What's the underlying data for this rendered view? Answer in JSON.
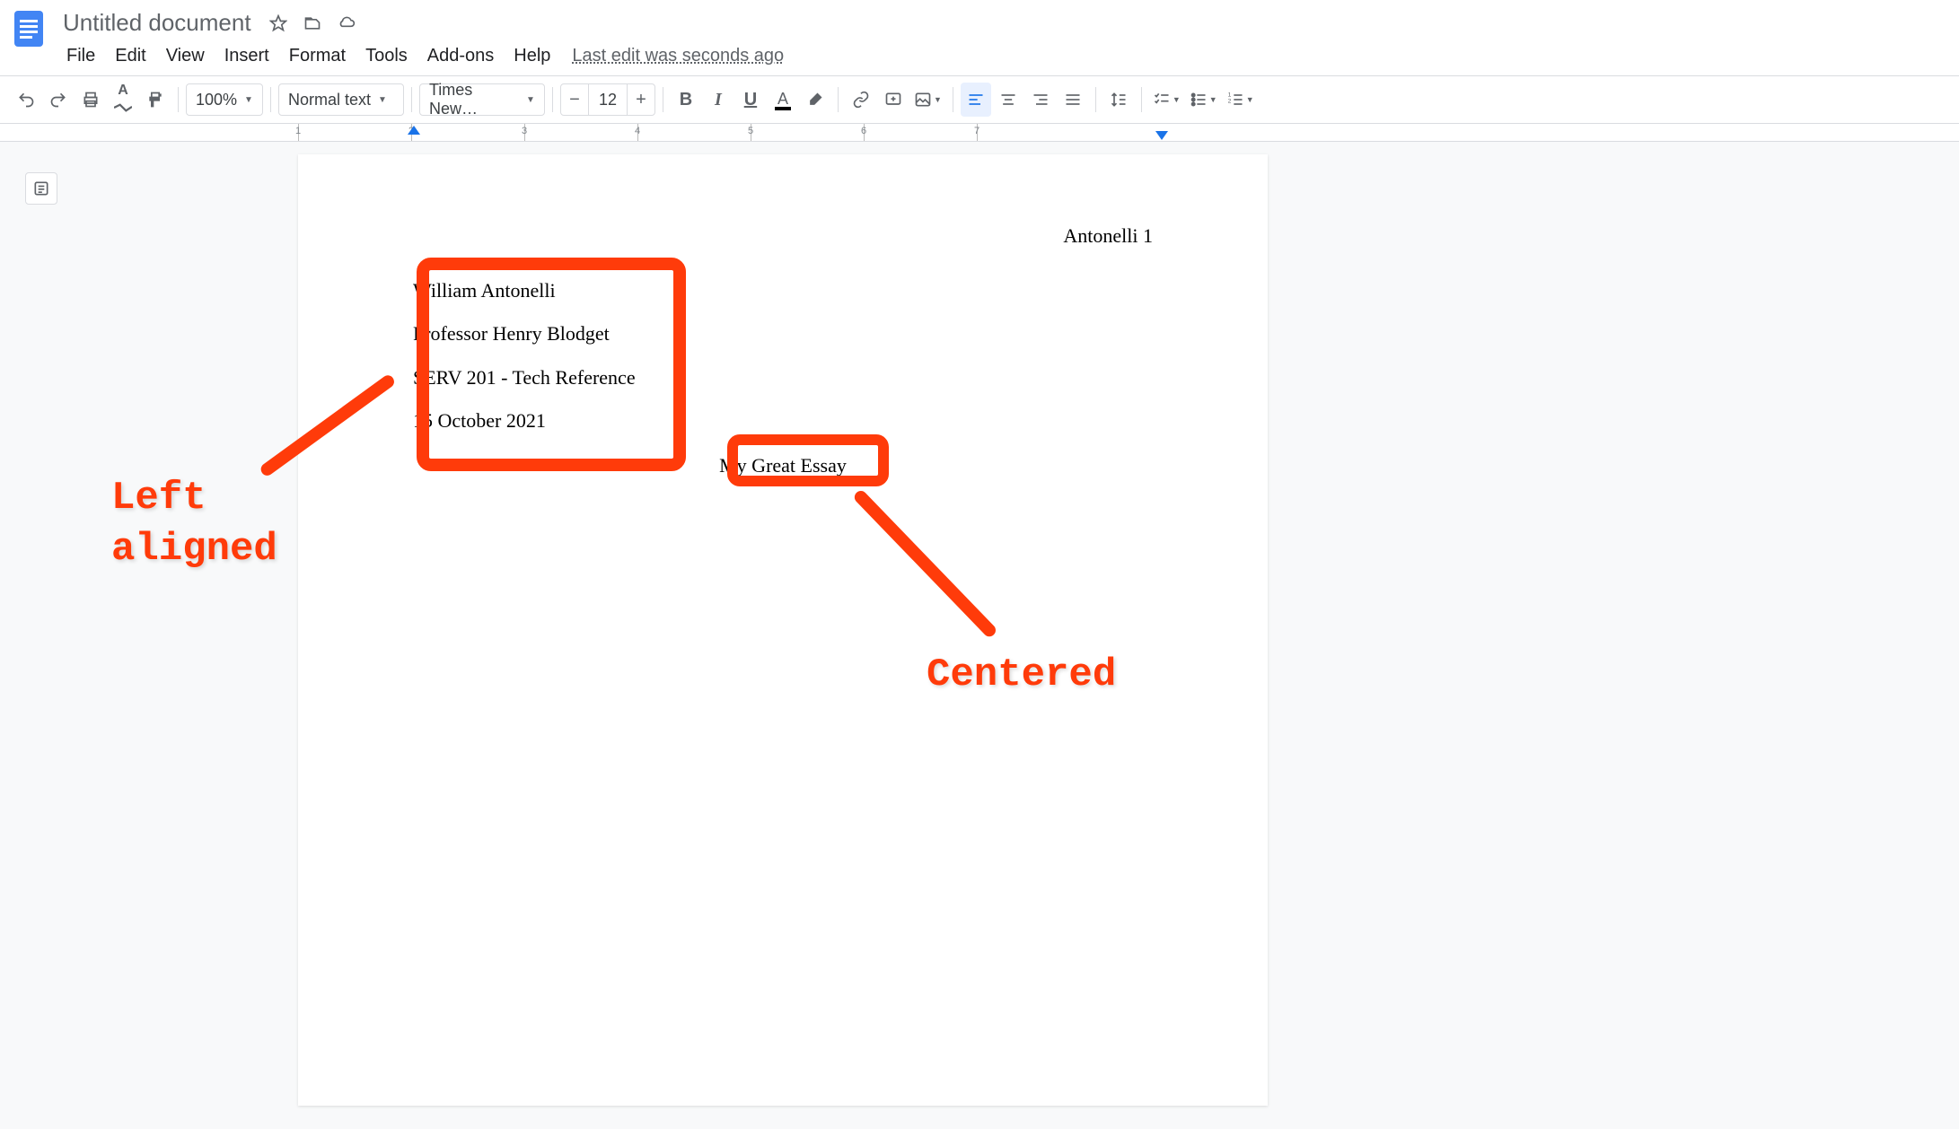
{
  "header": {
    "doc_title": "Untitled document"
  },
  "menubar": {
    "items": [
      "File",
      "Edit",
      "View",
      "Insert",
      "Format",
      "Tools",
      "Add-ons",
      "Help"
    ],
    "last_edit": "Last edit was seconds ago"
  },
  "toolbar": {
    "zoom": "100%",
    "style": "Normal text",
    "font": "Times New…",
    "font_size": "12"
  },
  "ruler": {
    "numbers": [
      "1",
      "2",
      "3",
      "4",
      "5",
      "6",
      "7"
    ]
  },
  "document": {
    "header_text": "Antonelli 1",
    "lines": [
      "William Antonelli",
      "Professor Henry Blodget",
      "SERV 201 - Tech Reference",
      "15 October 2021"
    ],
    "title": "My Great Essay"
  },
  "annotations": {
    "label1_line1": "Left",
    "label1_line2": "aligned",
    "label2": "Centered"
  }
}
